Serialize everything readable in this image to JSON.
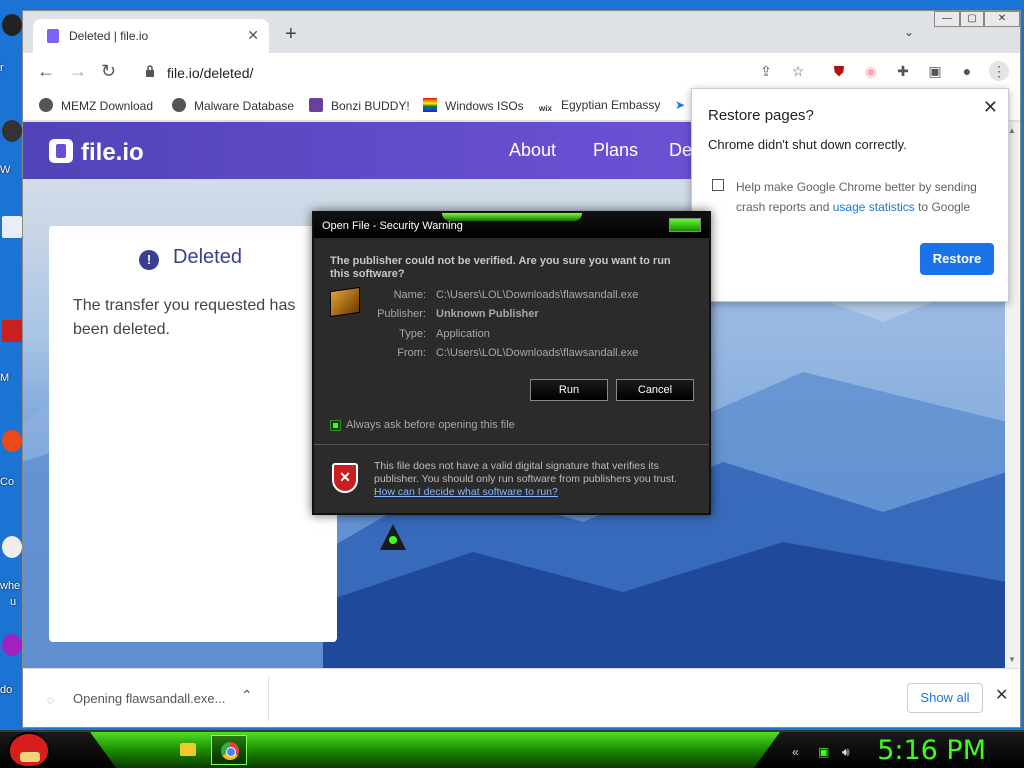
{
  "desktop": {
    "labels": [
      "r",
      "W",
      "M",
      "Co",
      "whe",
      "u",
      "do"
    ]
  },
  "browser": {
    "tab": {
      "title": "Deleted | file.io"
    },
    "window_controls": {
      "minimize": "—",
      "maximize": "▢",
      "close": "✕"
    },
    "url": "file.io/deleted/",
    "bookmarks": [
      {
        "label": "MEMZ Download"
      },
      {
        "label": "Malware Database"
      },
      {
        "label": "Bonzi BUDDY!"
      },
      {
        "label": "Windows ISOs"
      },
      {
        "label": "Egyptian Embassy"
      }
    ]
  },
  "site": {
    "logo": "file.io",
    "nav": [
      "About",
      "Plans",
      "De"
    ],
    "card": {
      "title": "Deleted",
      "message": "The transfer you requested has been deleted."
    }
  },
  "restore_popup": {
    "title": "Restore pages?",
    "subtitle": "Chrome didn't shut down correctly.",
    "help_before": "Help make Google Chrome better by sending crash reports and ",
    "help_link": "usage statistics",
    "help_after": " to Google",
    "button": "Restore"
  },
  "download_bar": {
    "item": "Opening flawsandall.exe...",
    "show_all": "Show all"
  },
  "security_dialog": {
    "title": "Open File - Security Warning",
    "question": "The publisher could not be verified.  Are you sure you want to run this software?",
    "fields": [
      {
        "key": "Name:",
        "value": "C:\\Users\\LOL\\Downloads\\flawsandall.exe"
      },
      {
        "key": "Publisher:",
        "value": "Unknown Publisher"
      },
      {
        "key": "Type:",
        "value": "Application"
      },
      {
        "key": "From:",
        "value": "C:\\Users\\LOL\\Downloads\\flawsandall.exe"
      }
    ],
    "run": "Run",
    "cancel": "Cancel",
    "always_ask": "Always ask before opening this file",
    "warning": "This file does not have a valid digital signature that verifies its publisher.  You should only run software from publishers you trust.",
    "help_link": "How can I decide what software to run?"
  },
  "taskbar": {
    "clock": "5:16 PM"
  },
  "colors": {
    "accent": "#6a4fd2",
    "taskbar_green": "#3cff1a",
    "restore_blue": "#1a73e8"
  }
}
